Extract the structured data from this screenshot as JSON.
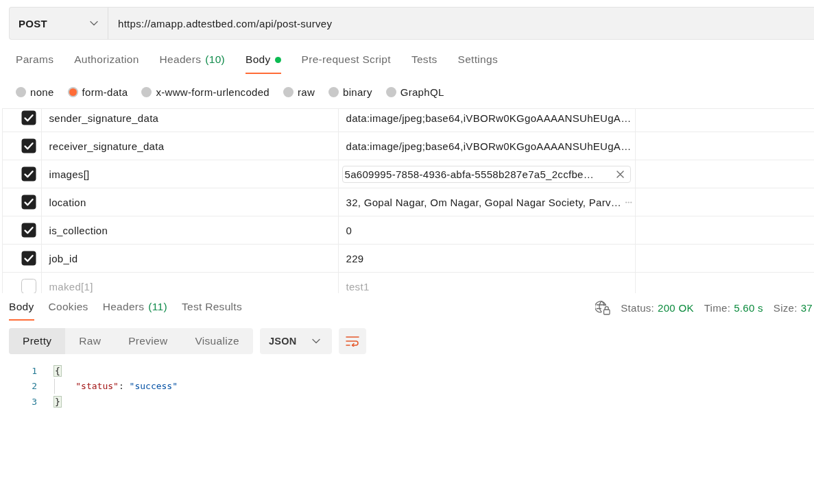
{
  "request": {
    "method": "POST",
    "url": "https://amapp.adtestbed.com/api/post-survey"
  },
  "request_tabs": [
    {
      "label": "Params",
      "selected": false,
      "dot": false
    },
    {
      "label": "Authorization",
      "selected": false,
      "dot": false
    },
    {
      "label": "Headers",
      "count": "(10)",
      "selected": false,
      "dot": false
    },
    {
      "label": "Body",
      "selected": true,
      "dot": true
    },
    {
      "label": "Pre-request Script",
      "selected": false,
      "dot": false
    },
    {
      "label": "Tests",
      "selected": false,
      "dot": false
    },
    {
      "label": "Settings",
      "selected": false,
      "dot": false
    }
  ],
  "body_types": [
    {
      "label": "none",
      "selected": false
    },
    {
      "label": "form-data",
      "selected": true
    },
    {
      "label": "x-www-form-urlencoded",
      "selected": false
    },
    {
      "label": "raw",
      "selected": false
    },
    {
      "label": "binary",
      "selected": false
    },
    {
      "label": "GraphQL",
      "selected": false
    }
  ],
  "form_rows": [
    {
      "kind": "text",
      "enabled": true,
      "key": "sender_signature_data",
      "value": "data:image/jpeg;base64,iVBORw0KGgoAAAANSUhEUgA…"
    },
    {
      "kind": "text",
      "enabled": true,
      "key": "receiver_signature_data",
      "value": "data:image/jpeg;base64,iVBORw0KGgoAAAANSUhEUgA…"
    },
    {
      "kind": "file",
      "enabled": true,
      "key": "images[]",
      "value": "5a609995-7858-4936-abfa-5558b287e7a5_2ccfbe…"
    },
    {
      "kind": "long_text",
      "enabled": true,
      "key": "location",
      "value": "32, Gopal Nagar, Om Nagar, Gopal Nagar Society, Parv…"
    },
    {
      "kind": "text",
      "enabled": true,
      "key": "is_collection",
      "value": "0"
    },
    {
      "kind": "text",
      "enabled": true,
      "key": "job_id",
      "value": "229"
    },
    {
      "kind": "text",
      "enabled": false,
      "key": "maked[1]",
      "value": "test1"
    }
  ],
  "response_tabs": [
    {
      "label": "Body",
      "selected": true
    },
    {
      "label": "Cookies",
      "selected": false
    },
    {
      "label": "Headers",
      "count": "(11)",
      "selected": false
    },
    {
      "label": "Test Results",
      "selected": false
    }
  ],
  "response_meta": [
    {
      "label": "Status:",
      "value": "200 OK"
    },
    {
      "label": "Time:",
      "value": "5.60 s"
    },
    {
      "label": "Size:",
      "value": "37"
    }
  ],
  "view_modes": [
    {
      "label": "Pretty",
      "selected": true
    },
    {
      "label": "Raw",
      "selected": false
    },
    {
      "label": "Preview",
      "selected": false
    },
    {
      "label": "Visualize",
      "selected": false
    }
  ],
  "format": "JSON",
  "code_lines": [
    {
      "number": "1",
      "indented": false,
      "tokens": [
        {
          "kind": "bracket",
          "text": "{"
        }
      ]
    },
    {
      "number": "2",
      "indented": true,
      "tokens": [
        {
          "kind": "key",
          "text": "\"status\""
        },
        {
          "kind": "punct",
          "text": ": "
        },
        {
          "kind": "string",
          "text": "\"success\""
        }
      ]
    },
    {
      "number": "3",
      "indented": false,
      "tokens": [
        {
          "kind": "bracket",
          "text": "}"
        }
      ]
    }
  ]
}
